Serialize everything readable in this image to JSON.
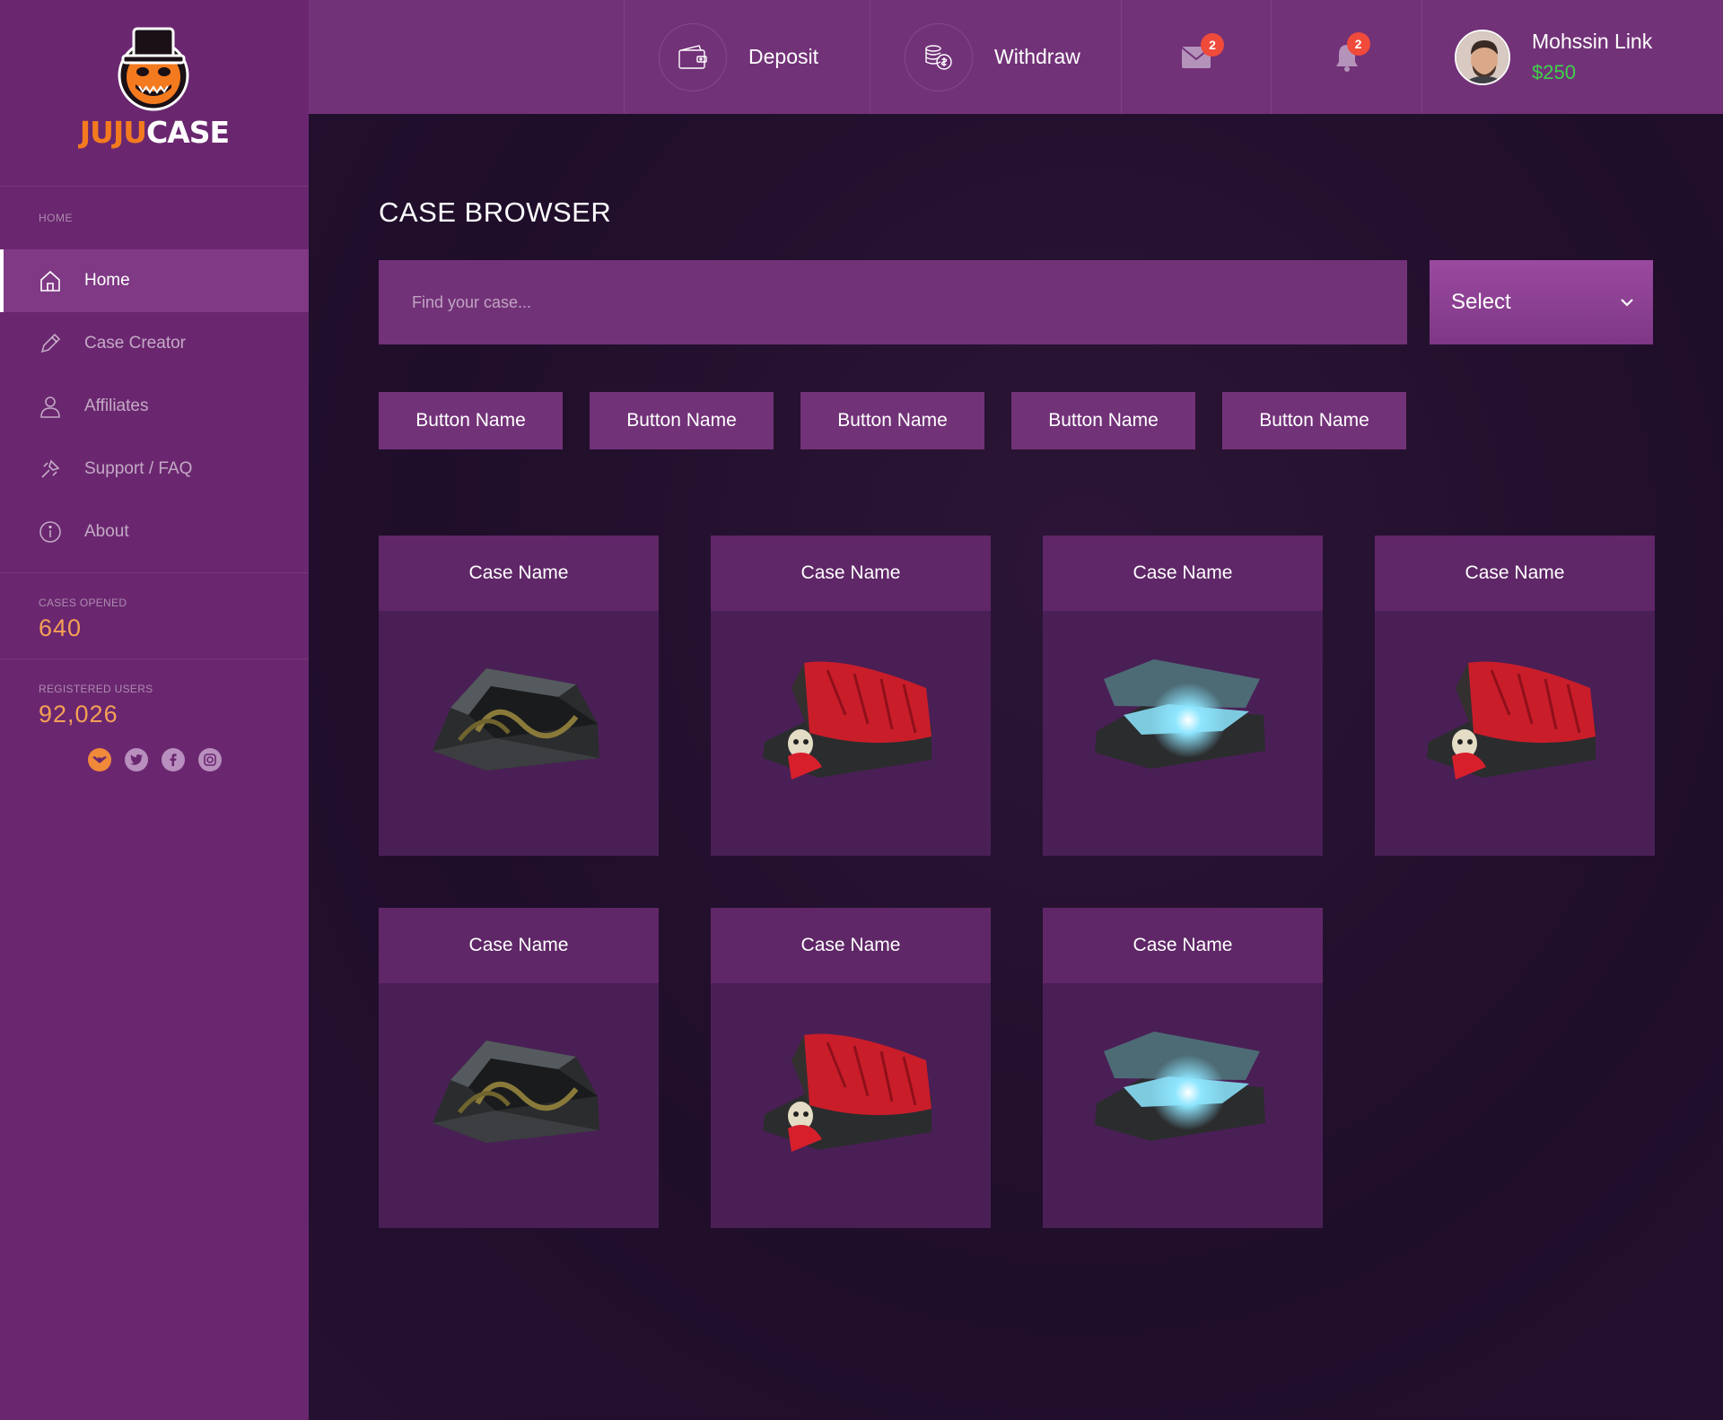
{
  "brand": {
    "part1": "JUJU",
    "part2": "CASE"
  },
  "sidebar": {
    "section_label": "HOME",
    "items": [
      {
        "label": "Home",
        "icon": "home-icon",
        "active": true
      },
      {
        "label": "Case Creator",
        "icon": "pencil-icon"
      },
      {
        "label": "Affiliates",
        "icon": "user-icon"
      },
      {
        "label": "Support / FAQ",
        "icon": "support-icon"
      },
      {
        "label": "About",
        "icon": "info-icon"
      }
    ],
    "stats": [
      {
        "label": "CASES OPENED",
        "value": "640"
      },
      {
        "label": "REGISTERED USERS",
        "value": "92,026"
      }
    ],
    "socials": [
      "bat-icon",
      "twitter-icon",
      "facebook-icon",
      "instagram-icon"
    ]
  },
  "topbar": {
    "deposit_label": "Deposit",
    "withdraw_label": "Withdraw",
    "messages_count": "2",
    "notifications_count": "2",
    "user": {
      "name": "Mohssin Link",
      "balance": "$250"
    }
  },
  "main": {
    "title": "CASE BROWSER",
    "search_placeholder": "Find your case...",
    "select_label": "Select",
    "filters": [
      "Button Name",
      "Button Name",
      "Button Name",
      "Button Name",
      "Button Name"
    ],
    "cases": [
      {
        "name": "Case Name",
        "variant": "snakes"
      },
      {
        "name": "Case Name",
        "variant": "red-cloth"
      },
      {
        "name": "Case Name",
        "variant": "glow"
      },
      {
        "name": "Case Name",
        "variant": "red-cloth"
      },
      {
        "name": "Case Name",
        "variant": "snakes"
      },
      {
        "name": "Case Name",
        "variant": "red-cloth"
      },
      {
        "name": "Case Name",
        "variant": "glow"
      }
    ]
  },
  "colors": {
    "accent": "#723278",
    "sidebar": "#6a276f",
    "stat": "#f5a056",
    "balance": "#3dd34a",
    "badge": "#ef4a3a"
  }
}
